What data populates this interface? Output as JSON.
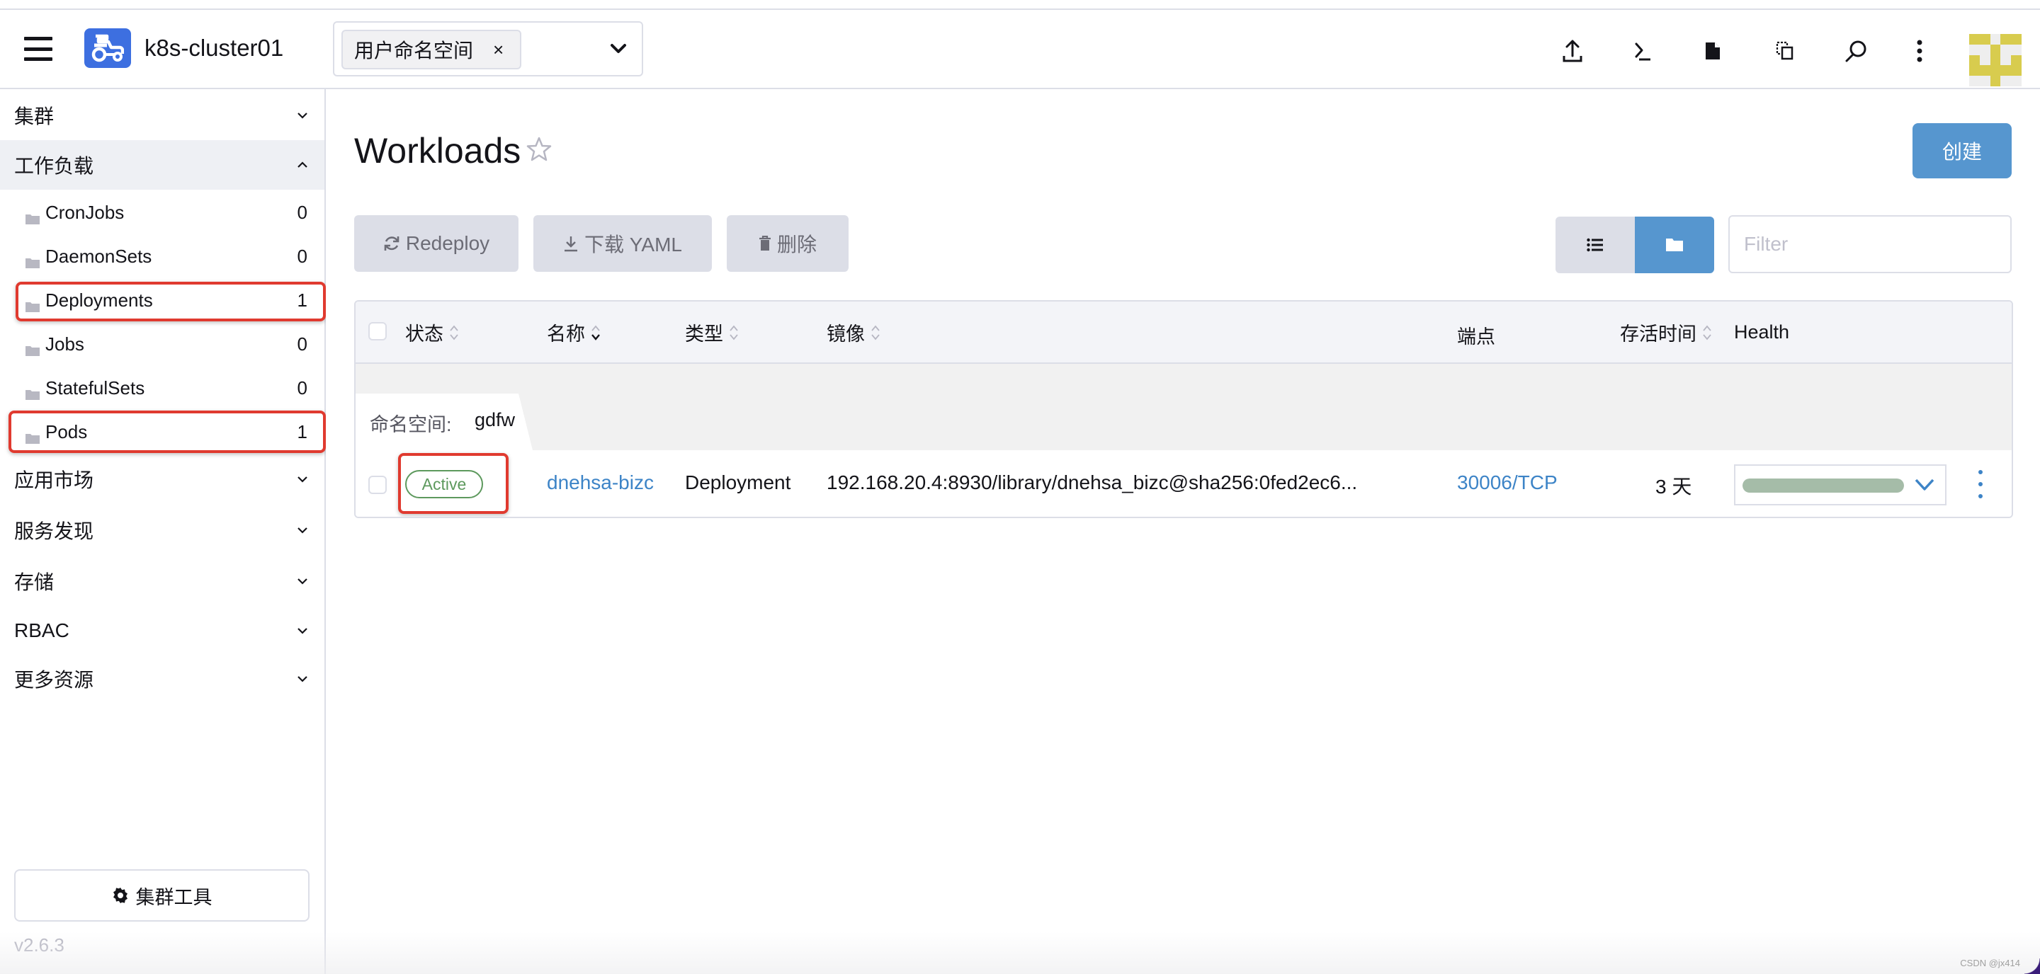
{
  "header": {
    "cluster_name": "k8s-cluster01",
    "namespace_selector": {
      "chip_label": "用户命名空间",
      "chip_remove": "×"
    },
    "icons": [
      "upload-icon",
      "terminal-icon",
      "file-icon",
      "copy-icon",
      "search-icon",
      "more-vertical-icon"
    ],
    "avatar_colors": {
      "on": "#d8cc4e",
      "off": "#eeeeee"
    }
  },
  "sidebar": {
    "groups": [
      {
        "label": "集群",
        "expanded": false
      },
      {
        "label": "工作负载",
        "expanded": true
      },
      {
        "label": "应用市场",
        "expanded": false
      },
      {
        "label": "服务发现",
        "expanded": false
      },
      {
        "label": "存储",
        "expanded": false
      },
      {
        "label": "RBAC",
        "expanded": false
      },
      {
        "label": "更多资源",
        "expanded": false
      }
    ],
    "workload_items": [
      {
        "label": "CronJobs",
        "count": "0"
      },
      {
        "label": "DaemonSets",
        "count": "0"
      },
      {
        "label": "Deployments",
        "count": "1",
        "highlighted": true
      },
      {
        "label": "Jobs",
        "count": "0"
      },
      {
        "label": "StatefulSets",
        "count": "0"
      },
      {
        "label": "Pods",
        "count": "1",
        "highlighted": true
      }
    ],
    "tools_button": "集群工具",
    "version": "v2.6.3"
  },
  "main": {
    "title": "Workloads",
    "create_button": "创建",
    "actions": {
      "redeploy": "Redeploy",
      "download_yaml": "下载 YAML",
      "delete": "删除"
    },
    "filter_placeholder": "Filter",
    "accent_color": "#5696cf",
    "table": {
      "columns": {
        "state": "状态",
        "name": "名称",
        "type": "类型",
        "image": "镜像",
        "endpoints": "端点",
        "age": "存活时间",
        "health": "Health"
      },
      "group": {
        "label": "命名空间:",
        "value": "gdfw"
      },
      "rows": [
        {
          "state": "Active",
          "name": "dnehsa-bizc",
          "type": "Deployment",
          "image": "192.168.20.4:8930/library/dnehsa_bizc@sha256:0fed2ec6...",
          "endpoint": "30006/TCP",
          "age": "3 天",
          "health_fraction": 1.0
        }
      ]
    }
  },
  "watermark": "CSDN @jx414"
}
